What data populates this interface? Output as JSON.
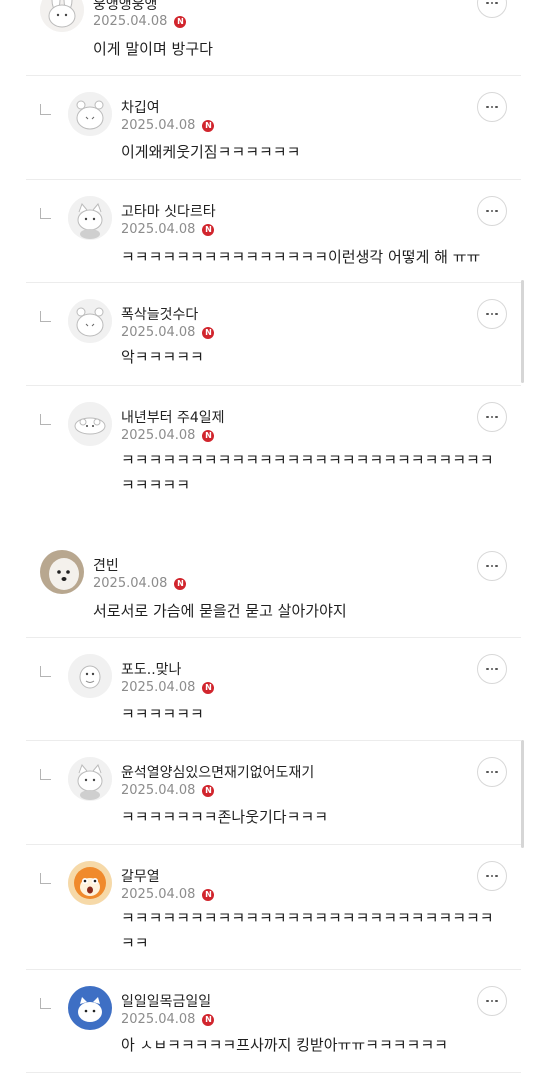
{
  "comments": [
    {
      "author": "웅앵앵웅앵",
      "date": "2025.04.08",
      "badge": "N",
      "text": "이게 말이며 방구다",
      "avatar_icon": "rabbit-character-icon"
    },
    {
      "author": "차깁여",
      "date": "2025.04.08",
      "badge": "N",
      "text": "이게왜케웃기짐ㅋㅋㅋㅋㅋㅋ",
      "avatar_icon": "hamster-character-icon"
    },
    {
      "author": "고타마 싯다르타",
      "date": "2025.04.08",
      "badge": "N",
      "text": "ㅋㅋㅋㅋㅋㅋㅋㅋㅋㅋㅋㅋㅋㅋㅋ이런생각 어떻게 해 ㅠㅠ",
      "avatar_icon": "cat-character-icon"
    },
    {
      "author": "폭삭늘것수다",
      "date": "2025.04.08",
      "badge": "N",
      "text": "악ㅋㅋㅋㅋㅋ",
      "avatar_icon": "hamster-character-icon"
    },
    {
      "author": "내년부터 주4일제",
      "date": "2025.04.08",
      "badge": "N",
      "text": "ㅋㅋㅋㅋㅋㅋㅋㅋㅋㅋㅋㅋㅋㅋㅋㅋㅋㅋㅋㅋㅋㅋㅋㅋㅋㅋㅋㅋㅋㅋㅋㅋ",
      "avatar_icon": "animal-character-icon"
    },
    {
      "author": "견빈",
      "date": "2025.04.08",
      "badge": "N",
      "text": "서로서로 가슴에 묻을건 묻고 살아가야지",
      "avatar_icon": "dog-photo-icon"
    },
    {
      "author": "포도..맞나",
      "date": "2025.04.08",
      "badge": "N",
      "text": "ㅋㅋㅋㅋㅋㅋ",
      "avatar_icon": "creature-character-icon"
    },
    {
      "author": "윤석열양심있으면재기없어도재기",
      "date": "2025.04.08",
      "badge": "N",
      "text": "ㅋㅋㅋㅋㅋㅋㅋ존나웃기다ㅋㅋㅋ",
      "avatar_icon": "cat-character-icon"
    },
    {
      "author": "갈무열",
      "date": "2025.04.08",
      "badge": "N",
      "text": "ㅋㅋㅋㅋㅋㅋㅋㅋㅋㅋㅋㅋㅋㅋㅋㅋㅋㅋㅋㅋㅋㅋㅋㅋㅋㅋㅋㅋㅋ",
      "avatar_icon": "orange-cartoon-icon"
    },
    {
      "author": "일일일목금일일",
      "date": "2025.04.08",
      "badge": "N",
      "text": "아 ㅅㅂㅋㅋㅋㅋㅋ프사까지 킹받아ㅠㅠㅋㅋㅋㅋㅋㅋ",
      "avatar_icon": "blue-cat-character-icon"
    }
  ]
}
